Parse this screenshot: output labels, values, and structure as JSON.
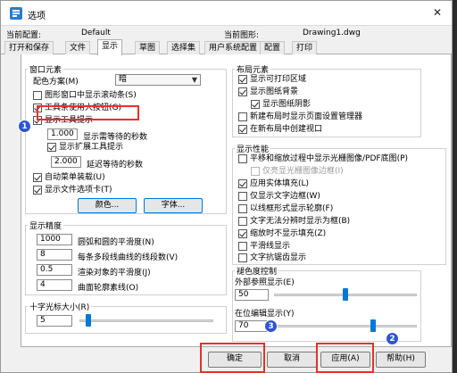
{
  "window": {
    "title": "选项",
    "close": "✕"
  },
  "config": {
    "current_profile_label": "当前配置:",
    "current_profile_value": "Default",
    "current_drawing_label": "当前图形:",
    "current_drawing_value": "Drawing1.dwg"
  },
  "tabs": [
    "打开和保存",
    "文件",
    "显示",
    "草图",
    "选择集",
    "用户系统配置",
    "配置",
    "打印"
  ],
  "active_tab": "显示",
  "window_elements": {
    "title": "窗口元素",
    "color_scheme_label": "配色方案(M)",
    "color_scheme_value": "暗",
    "checkboxes": [
      {
        "label": "图形窗口中显示滚动条(S)",
        "checked": false
      },
      {
        "label": "工具条使用大按钮(G)",
        "checked": true
      },
      {
        "label": "显示工具提示",
        "checked": true
      }
    ],
    "tooltip_delay_value": "1.000",
    "tooltip_delay_label": "显示需等待的秒数",
    "show_extended_tooltips": "显示扩展工具提示",
    "extended_delay_value": "2.000",
    "extended_delay_label": "延迟等待的秒数",
    "auto_menu_load": "自动菜单装载(U)",
    "file_tabs": "显示文件选项卡(T)",
    "color_button": "颜色...",
    "font_button": "字体..."
  },
  "display_precision": {
    "title": "显示精度",
    "rows": [
      {
        "value": "1000",
        "label": "圆弧和圆的平滑度(N)"
      },
      {
        "value": "8",
        "label": "每条多段线曲线的线段数(V)"
      },
      {
        "value": "0.5",
        "label": "渲染对象的平滑度(J)"
      },
      {
        "value": "4",
        "label": "曲面轮廓素线(O)"
      }
    ]
  },
  "crosshair": {
    "title": "十字光标大小(R)",
    "value": "5",
    "level": 5
  },
  "layout_elements": {
    "title": "布局元素",
    "items": [
      {
        "label": "显示可打印区域",
        "checked": true
      },
      {
        "label": "显示图纸背景",
        "checked": true
      },
      {
        "label": "显示图纸阴影",
        "checked": true
      },
      {
        "label": "新建布局时显示页面设置管理器",
        "checked": false
      },
      {
        "label": "在新布局中创建视口",
        "checked": true
      }
    ]
  },
  "display_performance": {
    "title": "显示性能",
    "items": [
      {
        "label": "平移和缩放过程中显示光栅图像/PDF底图(P)",
        "checked": false,
        "disabled": false
      },
      {
        "label": "仅亮显光栅图像边框(I)",
        "checked": false,
        "disabled": true
      },
      {
        "label": "应用实体填充(L)",
        "checked": true,
        "disabled": false
      },
      {
        "label": "仅显示文字边框(W)",
        "checked": false,
        "disabled": false
      },
      {
        "label": "以线框形式显示轮廓(F)",
        "checked": false,
        "disabled": false
      },
      {
        "label": "文字无法分辨时显示为框(B)",
        "checked": false,
        "disabled": false
      },
      {
        "label": "缩放时不显示填充(Z)",
        "checked": true,
        "disabled": false
      },
      {
        "label": "平滑线显示",
        "checked": false,
        "disabled": false
      },
      {
        "label": "文字抗锯齿显示",
        "checked": false,
        "disabled": false
      }
    ]
  },
  "fade_control": {
    "title": "褪色度控制",
    "xref_label": "外部参照显示(E)",
    "xref_value": "50",
    "xref_level": 50,
    "inplace_label": "在位编辑显示(Y)",
    "inplace_value": "70",
    "inplace_level": 70
  },
  "buttons": {
    "ok": "确定",
    "cancel": "取消",
    "apply": "应用(A)",
    "help": "帮助(H)"
  },
  "annotations": {
    "badge1": "1",
    "badge2": "2",
    "badge3": "3",
    "marker_color": "#e4322b",
    "badge_color": "#2f55d4"
  },
  "accent_color": "#0078d7"
}
